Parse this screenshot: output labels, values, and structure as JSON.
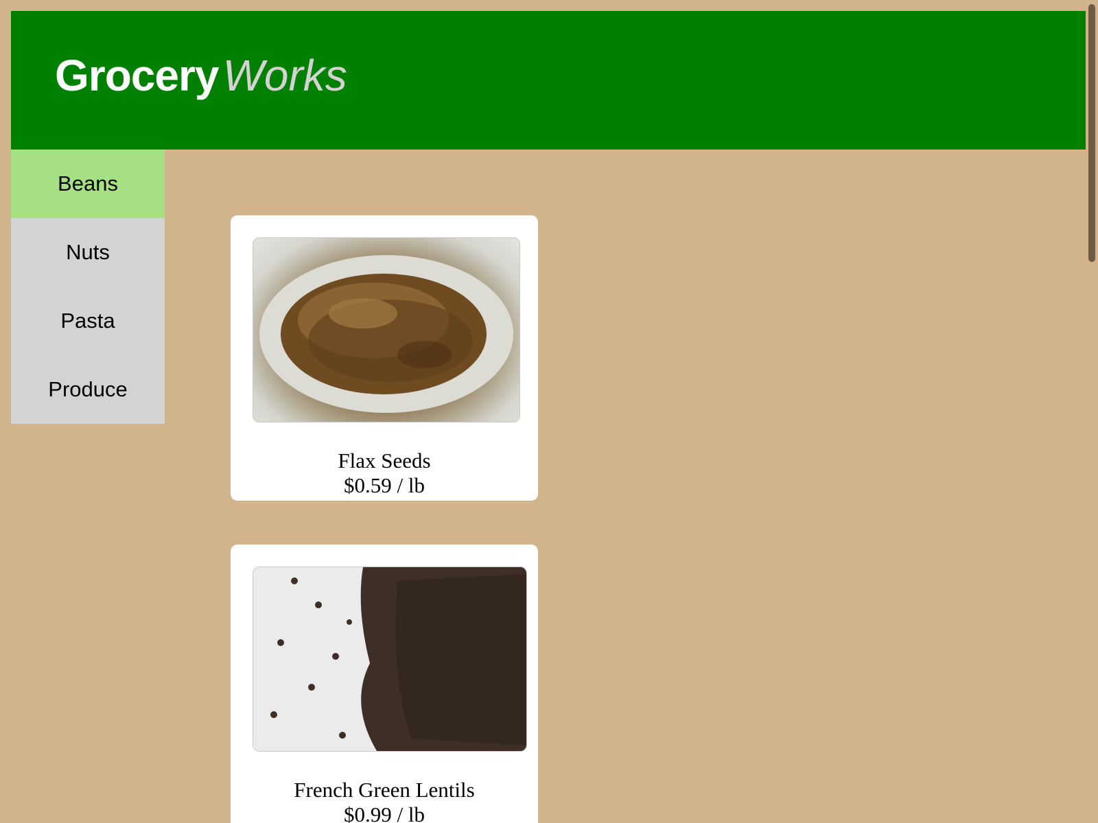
{
  "brand": {
    "strong": "Grocery",
    "emphasis": "Works"
  },
  "colors": {
    "background": "#d2b48c",
    "header": "#008000",
    "nav_active": "#a5e085",
    "nav_inactive": "#d3d3d3",
    "card": "#ffffff"
  },
  "sidebar": {
    "items": [
      {
        "label": "Beans",
        "active": true
      },
      {
        "label": "Nuts",
        "active": false
      },
      {
        "label": "Pasta",
        "active": false
      },
      {
        "label": "Produce",
        "active": false
      }
    ]
  },
  "products": [
    {
      "name": "Flax Seeds",
      "price": "$0.59 / lb",
      "image": "flax-seeds-photo"
    },
    {
      "name": "French Green Lentils",
      "price": "$0.99 / lb",
      "image": "french-green-lentils-photo"
    }
  ]
}
